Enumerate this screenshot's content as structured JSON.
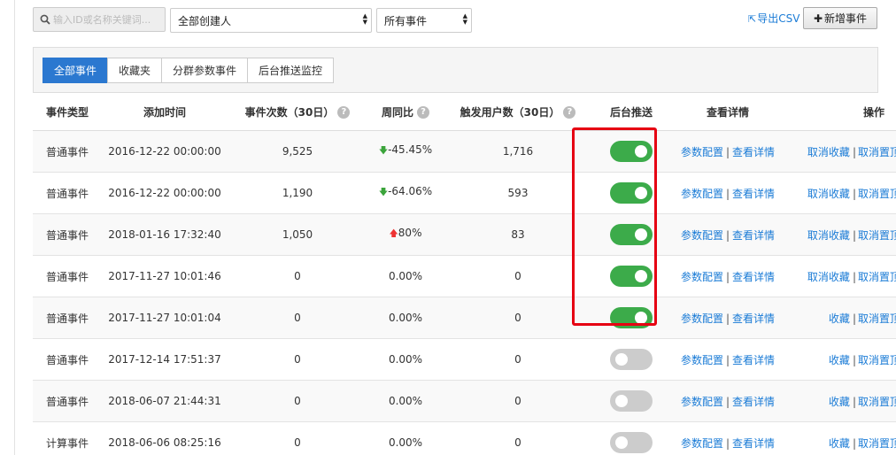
{
  "toolbar": {
    "search_placeholder": "输入ID或名称关键词...",
    "creator_select": "全部创建人",
    "event_select": "所有事件",
    "export_label": "导出CSV",
    "add_label": "新增事件"
  },
  "tabs": [
    {
      "label": "全部事件",
      "active": true
    },
    {
      "label": "收藏夹",
      "active": false
    },
    {
      "label": "分群参数事件",
      "active": false
    },
    {
      "label": "后台推送监控",
      "active": false
    }
  ],
  "columns": {
    "type": "事件类型",
    "time": "添加时间",
    "count": "事件次数（30日）",
    "wow": "周同比",
    "users": "触发用户数（30日）",
    "push": "后台推送",
    "details": "查看详情",
    "ops": "操作"
  },
  "links": {
    "param_config": "参数配置",
    "view_details": "查看详情",
    "unfavorite": "取消收藏",
    "favorite": "收藏",
    "unpin": "取消置顶"
  },
  "rows": [
    {
      "type": "普通事件",
      "time": "2016-12-22 00:00:00",
      "count": "9,525",
      "trend": "down",
      "wow": "-45.45%",
      "users": "1,716",
      "push": true,
      "fav": true
    },
    {
      "type": "普通事件",
      "time": "2016-12-22 00:00:00",
      "count": "1,190",
      "trend": "down",
      "wow": "-64.06%",
      "users": "593",
      "push": true,
      "fav": true
    },
    {
      "type": "普通事件",
      "time": "2018-01-16 17:32:40",
      "count": "1,050",
      "trend": "up",
      "wow": "80%",
      "users": "83",
      "push": true,
      "fav": true
    },
    {
      "type": "普通事件",
      "time": "2017-11-27 10:01:46",
      "count": "0",
      "trend": "none",
      "wow": "0.00%",
      "users": "0",
      "push": true,
      "fav": true
    },
    {
      "type": "普通事件",
      "time": "2017-11-27 10:01:04",
      "count": "0",
      "trend": "none",
      "wow": "0.00%",
      "users": "0",
      "push": true,
      "fav": false
    },
    {
      "type": "普通事件",
      "time": "2017-12-14 17:51:37",
      "count": "0",
      "trend": "none",
      "wow": "0.00%",
      "users": "0",
      "push": false,
      "fav": false
    },
    {
      "type": "普通事件",
      "time": "2018-06-07 21:44:31",
      "count": "0",
      "trend": "none",
      "wow": "0.00%",
      "users": "0",
      "push": false,
      "fav": false
    },
    {
      "type": "计算事件",
      "time": "2018-06-06 08:25:16",
      "count": "0",
      "trend": "none",
      "wow": "0.00%",
      "users": "0",
      "push": false,
      "fav": false
    }
  ],
  "colors": {
    "toggle_on": "#3cab4a",
    "toggle_off": "#cccccc",
    "link": "#1a7bd6",
    "tab_active": "#2b78d0",
    "highlight": "#e60012",
    "trend_down": "#3ba43b",
    "trend_up": "#e33333"
  }
}
